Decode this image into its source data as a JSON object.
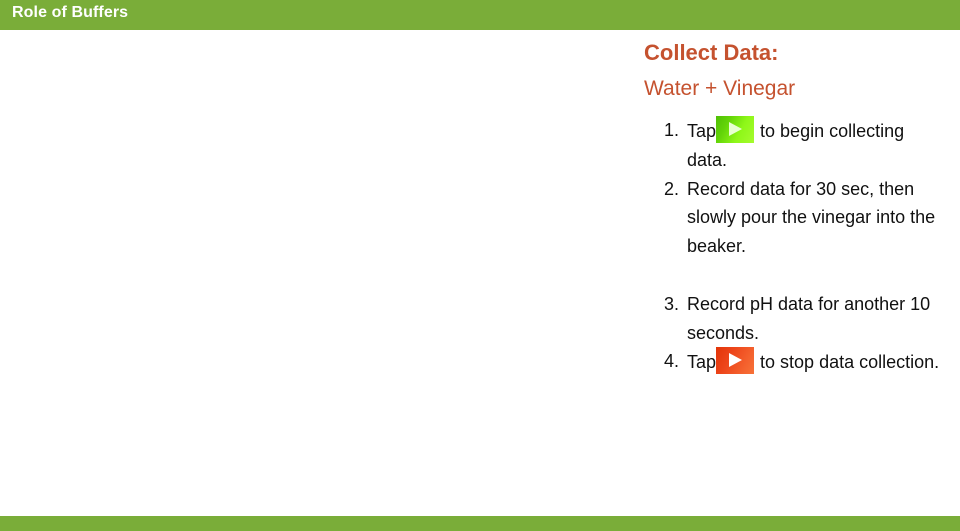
{
  "header": {
    "title": "Role of Buffers",
    "bar_color": "#7aad39"
  },
  "footer": {
    "bar_color": "#7aad39"
  },
  "slide": {
    "title": "Collect Data:",
    "subtitle": "Water + Vinegar",
    "accent_color": "#c5522f",
    "steps": [
      {
        "number": "1.",
        "text_before": "Tap",
        "icon": "play-button-green-icon",
        "icon_color": "#63d408",
        "text_after": " to begin collecting data."
      },
      {
        "number": "2.",
        "text_before": "Record data for 30 sec, then slowly pour the vinegar into the beaker.",
        "icon": null,
        "icon_color": null,
        "text_after": ""
      },
      {
        "number": "3.",
        "text_before": "Record pH data for another 10 seconds.",
        "icon": null,
        "icon_color": null,
        "text_after": ""
      },
      {
        "number": "4.",
        "text_before": "Tap",
        "icon": "play-button-red-icon",
        "icon_color": "#ed451a",
        "text_after": " to stop data collection."
      }
    ]
  }
}
